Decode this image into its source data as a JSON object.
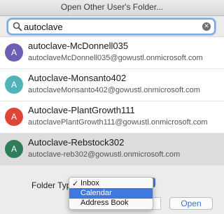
{
  "window": {
    "title": "Open Other User's Folder..."
  },
  "search": {
    "value": "autoclave",
    "clear_glyph": "✕"
  },
  "results": [
    {
      "name": "autoclave-McDonnell035",
      "email": "autoclaveMcDonnell035@gowustl.onmicrosoft.com",
      "initial": "A",
      "color": "#6f5fb3"
    },
    {
      "name": "Autoclave-Monsanto402",
      "email": "autoclaveMonsanto402@gowustl.onmicrosoft.com",
      "initial": "A",
      "color": "#4fb4b7"
    },
    {
      "name": "Autoclave-PlantGrowth111",
      "email": "autoclavePlantGrowth111@gowustl.onmicrosoft.com",
      "initial": "A",
      "color": "#e0453a"
    },
    {
      "name": "Autoclave-Rebstock302",
      "email": "autoclave-reb302@gowustl.onmicrosoft.com",
      "initial": "A",
      "color": "#2f7d5a"
    }
  ],
  "folder_type": {
    "label": "Folder Type",
    "options": [
      "Inbox",
      "Calendar",
      "Address Book"
    ],
    "checked": "Inbox",
    "highlighted": "Calendar",
    "check_glyph": "✓"
  },
  "actions": {
    "open_label": "Open"
  },
  "colors": {
    "accent": "#3d79e0",
    "selected_row": "#dcdcdc"
  }
}
